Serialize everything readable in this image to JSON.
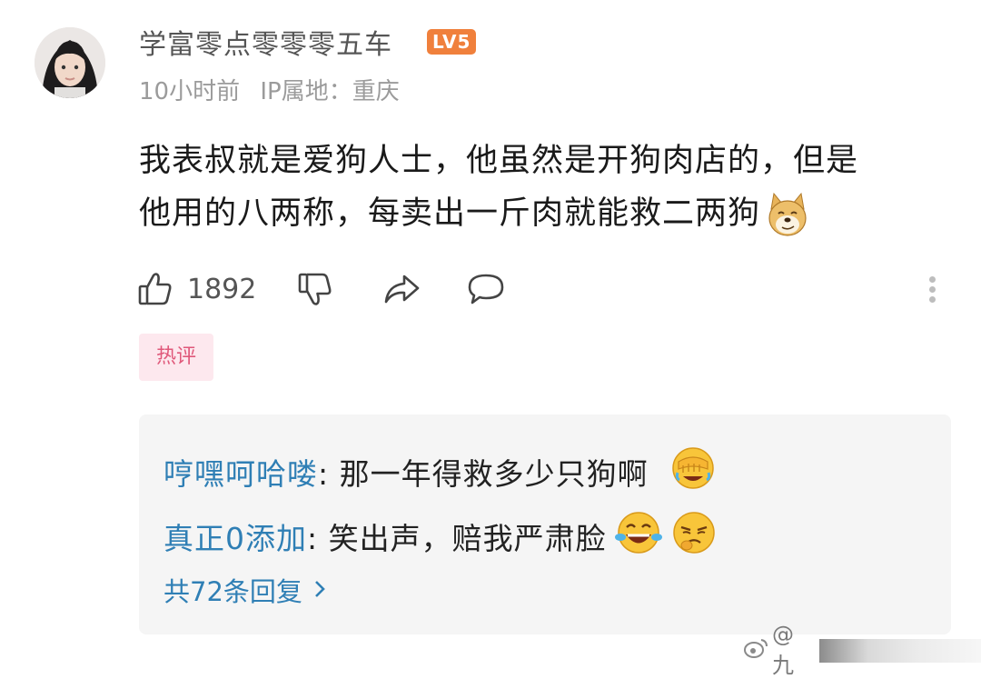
{
  "comment": {
    "username": "学富零点零零零五车",
    "level_badge": "LV5",
    "time": "10小时前",
    "ip_location": "IP属地：重庆",
    "text_line1": "我表叔就是爱狗人士，他虽然是开狗肉店的，但是",
    "text_line2": "他用的八两称，每卖出一斤肉就能救二两狗",
    "inline_emoji": "doge-emoji",
    "likes": "1892",
    "hot_tag": "热评"
  },
  "replies": [
    {
      "author": "哼嘿呵哈喽",
      "text": ": 那一年得救多少只狗啊",
      "emoji": "facepalm-laugh-emoji"
    },
    {
      "author": "真正0添加",
      "text": ": 笑出声，赔我严肃脸",
      "emoji": "laugh-cry-emoji"
    }
  ],
  "reply_count_label": "共72条回复",
  "watermark": "@九",
  "colors": {
    "accent_blue": "#2f7fb5",
    "hot_pink": "#e0587a",
    "badge_orange": "#f0803c"
  }
}
